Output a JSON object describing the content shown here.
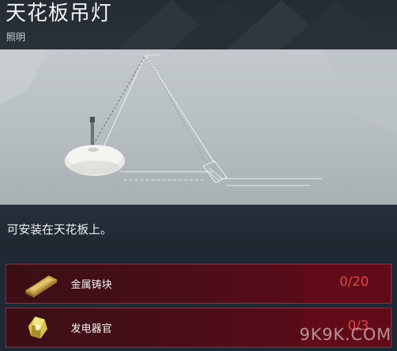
{
  "item": {
    "title": "天花板吊灯",
    "category": "照明",
    "description": "可安装在天花板上。"
  },
  "requirements": [
    {
      "name": "金属铸块",
      "count": "0/20",
      "icon": "metal-ingot-icon"
    },
    {
      "name": "发电器官",
      "count": "0/3",
      "icon": "generator-organ-icon"
    }
  ],
  "watermark": "9K9K.COM",
  "colors": {
    "header_bg": "#252b33",
    "preview_bg": "#c3c9cc",
    "requirement_bg": "#4a0e18",
    "requirement_border": "#8a3c45",
    "count_red": "#e0444e"
  }
}
